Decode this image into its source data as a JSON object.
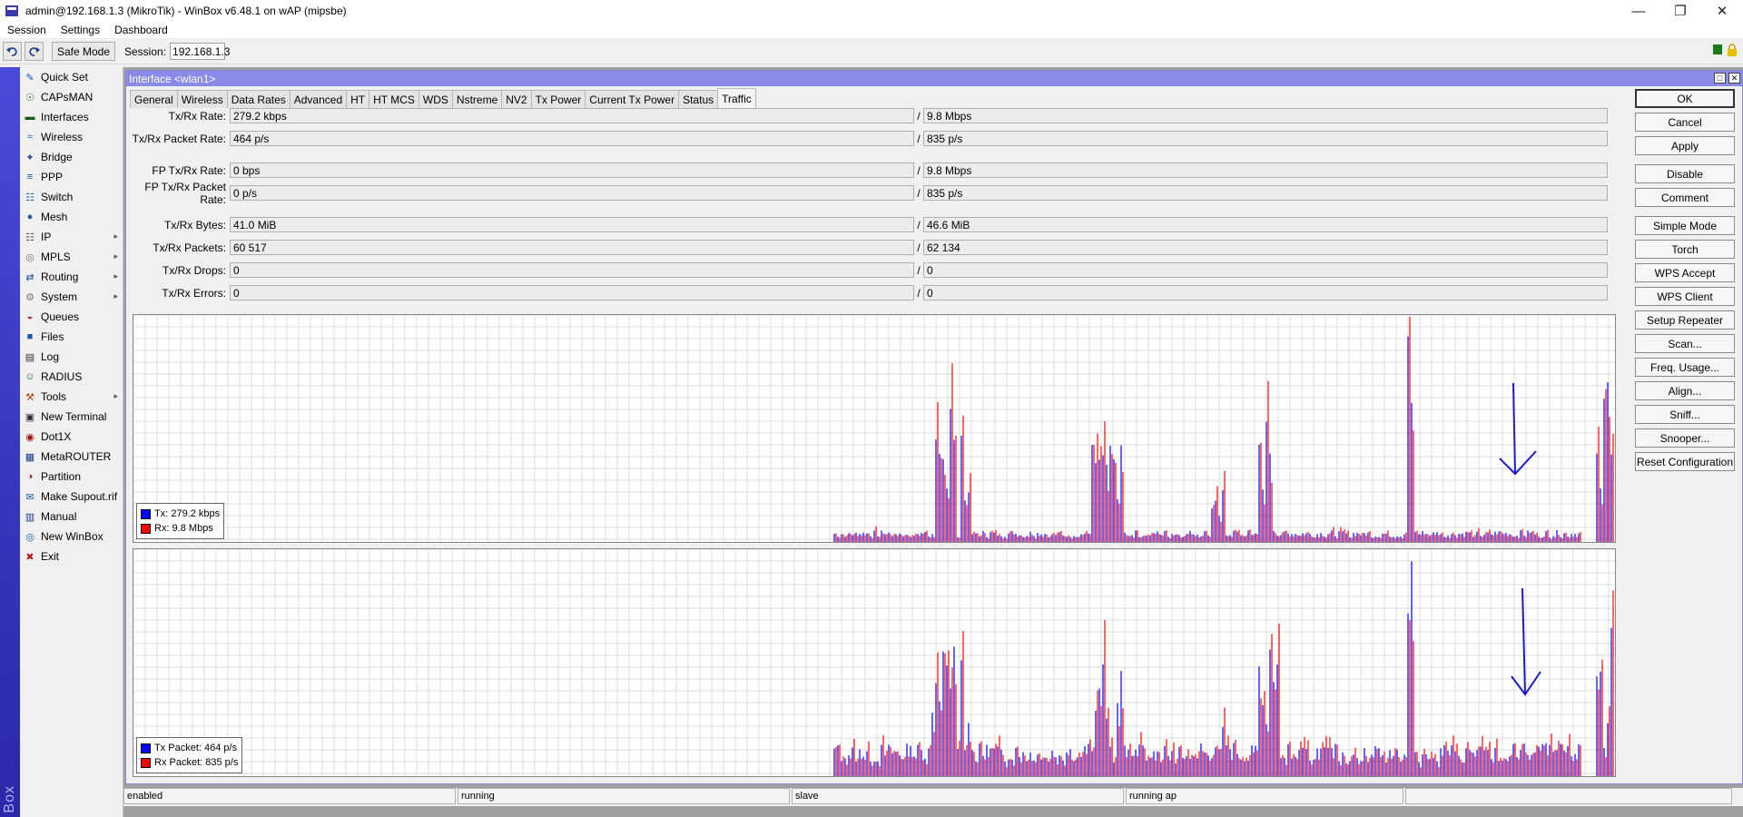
{
  "app": {
    "title": "admin@192.168.1.3 (MikroTik) - WinBox v6.48.1 on wAP (mipsbe)",
    "brand_vertical": "Box"
  },
  "menu": [
    "Session",
    "Settings",
    "Dashboard"
  ],
  "toolbar": {
    "safe_mode": "Safe Mode",
    "session_label": "Session:",
    "session_value": "192.168.1.3"
  },
  "sidebar": {
    "items": [
      {
        "label": "Quick Set",
        "icon": "quick-set-icon",
        "arrow": false
      },
      {
        "label": "CAPsMAN",
        "icon": "capsman-icon",
        "arrow": false
      },
      {
        "label": "Interfaces",
        "icon": "interfaces-icon",
        "arrow": false
      },
      {
        "label": "Wireless",
        "icon": "wireless-icon",
        "arrow": false
      },
      {
        "label": "Bridge",
        "icon": "bridge-icon",
        "arrow": false
      },
      {
        "label": "PPP",
        "icon": "ppp-icon",
        "arrow": false
      },
      {
        "label": "Switch",
        "icon": "switch-icon",
        "arrow": false
      },
      {
        "label": "Mesh",
        "icon": "mesh-icon",
        "arrow": false
      },
      {
        "label": "IP",
        "icon": "ip-icon",
        "arrow": true
      },
      {
        "label": "MPLS",
        "icon": "mpls-icon",
        "arrow": true
      },
      {
        "label": "Routing",
        "icon": "routing-icon",
        "arrow": true
      },
      {
        "label": "System",
        "icon": "system-icon",
        "arrow": true
      },
      {
        "label": "Queues",
        "icon": "queues-icon",
        "arrow": false
      },
      {
        "label": "Files",
        "icon": "files-icon",
        "arrow": false
      },
      {
        "label": "Log",
        "icon": "log-icon",
        "arrow": false
      },
      {
        "label": "RADIUS",
        "icon": "radius-icon",
        "arrow": false
      },
      {
        "label": "Tools",
        "icon": "tools-icon",
        "arrow": true
      },
      {
        "label": "New Terminal",
        "icon": "terminal-icon",
        "arrow": false
      },
      {
        "label": "Dot1X",
        "icon": "dot1x-icon",
        "arrow": false
      },
      {
        "label": "MetaROUTER",
        "icon": "metarouter-icon",
        "arrow": false
      },
      {
        "label": "Partition",
        "icon": "partition-icon",
        "arrow": false
      },
      {
        "label": "Make Supout.rif",
        "icon": "supout-icon",
        "arrow": false
      },
      {
        "label": "Manual",
        "icon": "manual-icon",
        "arrow": false
      },
      {
        "label": "New WinBox",
        "icon": "winbox-icon",
        "arrow": false
      },
      {
        "label": "Exit",
        "icon": "exit-icon",
        "arrow": false
      }
    ]
  },
  "window": {
    "title": "Interface <wlan1>",
    "tabs": [
      "General",
      "Wireless",
      "Data Rates",
      "Advanced",
      "HT",
      "HT MCS",
      "WDS",
      "Nstreme",
      "NV2",
      "Tx Power",
      "Current Tx Power",
      "Status",
      "Traffic"
    ],
    "active_tab": "Traffic",
    "fields": [
      {
        "label": "Tx/Rx Rate:",
        "tx": "279.2 kbps",
        "rx": "9.8 Mbps"
      },
      {
        "label": "Tx/Rx Packet Rate:",
        "tx": "464 p/s",
        "rx": "835 p/s"
      },
      {
        "label": "FP Tx/Rx Rate:",
        "tx": "0 bps",
        "rx": "9.8 Mbps"
      },
      {
        "label": "FP Tx/Rx Packet Rate:",
        "tx": "0 p/s",
        "rx": "835 p/s"
      },
      {
        "label": "Tx/Rx Bytes:",
        "tx": "41.0 MiB",
        "rx": "46.6 MiB"
      },
      {
        "label": "Tx/Rx Packets:",
        "tx": "60 517",
        "rx": "62 134"
      },
      {
        "label": "Tx/Rx Drops:",
        "tx": "0",
        "rx": "0"
      },
      {
        "label": "Tx/Rx Errors:",
        "tx": "0",
        "rx": "0"
      }
    ],
    "graph_rate_legend": [
      {
        "label": "Tx:  279.2 kbps",
        "color": "#0000ff"
      },
      {
        "label": "Rx:  9.8 Mbps",
        "color": "#ff0000"
      }
    ],
    "graph_packet_legend": [
      {
        "label": "Tx Packet:  464 p/s",
        "color": "#0000ff"
      },
      {
        "label": "Rx Packet:  835 p/s",
        "color": "#ff0000"
      }
    ],
    "buttons": [
      "OK",
      "Cancel",
      "Apply",
      "Disable",
      "Comment",
      "Simple Mode",
      "Torch",
      "WPS Accept",
      "WPS Client",
      "Setup Repeater",
      "Scan...",
      "Freq. Usage...",
      "Align...",
      "Sniff...",
      "Snooper...",
      "Reset Configuration"
    ]
  },
  "statusbar": [
    "enabled",
    "running",
    "slave",
    "running ap",
    ""
  ],
  "colors": {
    "tx": "#0000ff",
    "rx": "#ff0000",
    "title_bar": "#8a8ae8",
    "annotation": "#1a1ad0"
  }
}
